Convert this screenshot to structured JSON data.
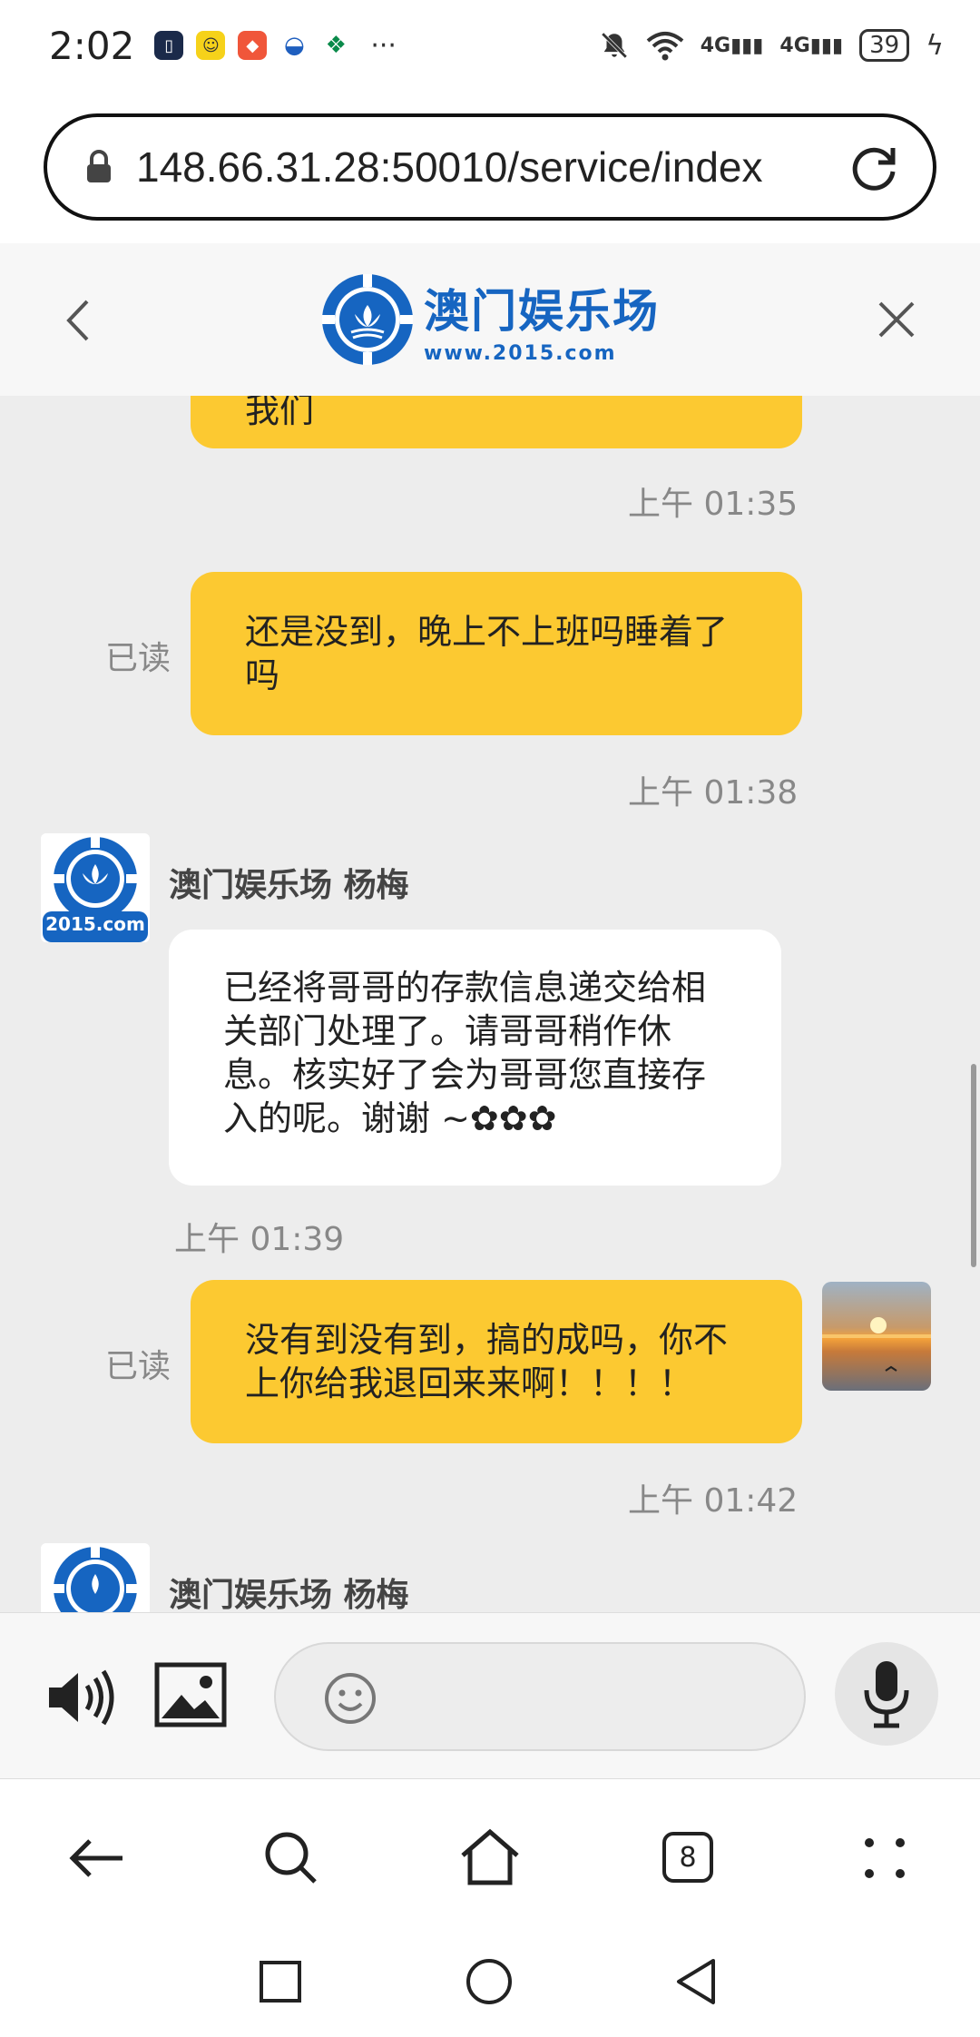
{
  "status": {
    "time": "2:02",
    "more": "···",
    "net1": "4G",
    "net2": "4G",
    "battery": "39"
  },
  "browser": {
    "url": "148.66.31.28:50010/service/index",
    "tab_count": "8"
  },
  "header": {
    "logo_name": "澳门娱乐场",
    "logo_site": "www.2015.com"
  },
  "chat": {
    "messages": [
      {
        "type": "me",
        "text": "我们",
        "time": "上午 01:35"
      },
      {
        "type": "me",
        "read": "已读",
        "text": "还是没到，晚上不上班吗睡着了吗",
        "time": "上午 01:38"
      },
      {
        "type": "other",
        "sender": "澳门娱乐场 杨梅",
        "avatar_label": "2015.com",
        "text": "已经将哥哥的存款信息递交给相关部门处理了。请哥哥稍作休息。核实好了会为哥哥您直接存入的呢。谢谢 ~✿✿✿",
        "time": "上午 01:39"
      },
      {
        "type": "me",
        "read": "已读",
        "text": "没有到没有到，搞的成吗，你不上你给我退回来来啊！！！！",
        "time": "上午 01:42"
      },
      {
        "type": "other",
        "sender": "澳门娱乐场 杨梅"
      }
    ]
  },
  "colors": {
    "bubble_me": "#fcc931",
    "brand_blue": "#1665c1",
    "chat_bg": "#ededed"
  }
}
